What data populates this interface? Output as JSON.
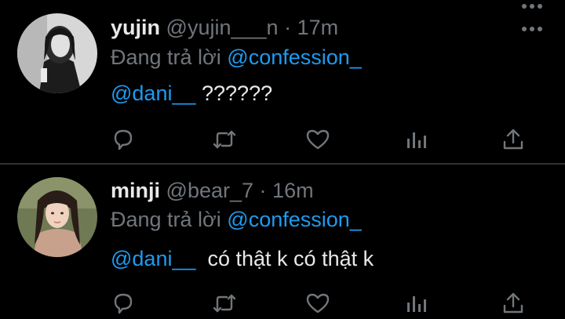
{
  "theme": {
    "background": "#000000",
    "text": "#e7e9ea",
    "muted": "#71767b",
    "accent": "#1d9bf0",
    "divider": "#2f3336"
  },
  "tweets": [
    {
      "name": "yujin",
      "handle": "@yujin___n",
      "separator": "·",
      "time": "17m",
      "reply_prefix": "Đang trả lời",
      "reply_to": "@confession_",
      "mention": "@dani__",
      "text": " ??????",
      "avatar": "grayscale-portrait-avatar",
      "actions": [
        "reply-icon",
        "retweet-icon",
        "like-icon",
        "views-icon",
        "share-icon"
      ]
    },
    {
      "name": "minji",
      "handle": "@bear_7",
      "separator": "·",
      "time": "16m",
      "reply_prefix": "Đang trả lời",
      "reply_to": "@confession_",
      "mention": "@dani__",
      "text": "  có thật k có thật k",
      "avatar": "portrait-avatar",
      "actions": [
        "reply-icon",
        "retweet-icon",
        "like-icon",
        "views-icon",
        "share-icon"
      ]
    }
  ]
}
